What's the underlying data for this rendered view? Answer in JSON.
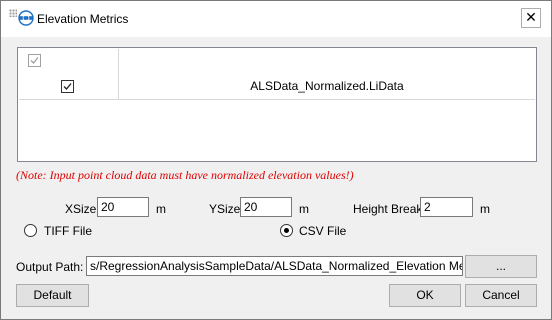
{
  "window": {
    "title": "Elevation Metrics",
    "close_glyph": "✕",
    "logo_icon": "lidar360-logo-icon"
  },
  "table": {
    "header_checked": true,
    "rows": [
      {
        "checked": true,
        "name": "ALSData_Normalized.LiData"
      }
    ]
  },
  "note": "(Note: Input point cloud data must have normalized elevation values!)",
  "params": {
    "xsize_label": "XSize",
    "xsize_value": "20",
    "xsize_unit": "m",
    "ysize_label": "YSize",
    "ysize_value": "20",
    "ysize_unit": "m",
    "hb_label": "Height Break",
    "hb_value": "2",
    "hb_unit": "m"
  },
  "format": {
    "tiff_label": "TIFF File",
    "csv_label": "CSV File",
    "selected": "CSV File"
  },
  "output": {
    "label": "Output Path:",
    "value": "s/RegressionAnalysisSampleData/ALSData_Normalized_Elevation Metrics.csv",
    "browse_label": "..."
  },
  "buttons": {
    "default_label": "Default",
    "ok_label": "OK",
    "cancel_label": "Cancel"
  },
  "colors": {
    "note": "#e00000",
    "logo": "#1e6fc2"
  }
}
